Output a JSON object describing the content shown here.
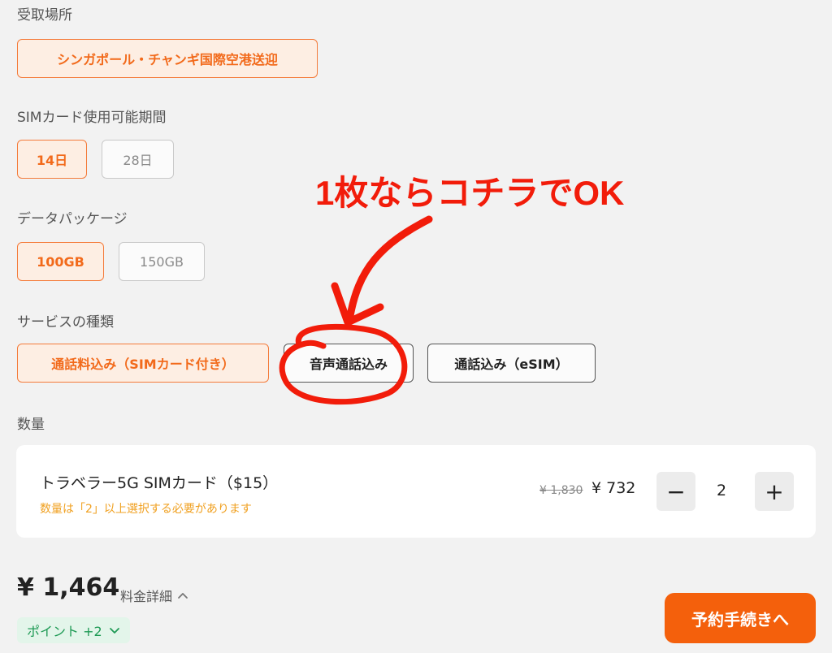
{
  "pickup": {
    "label": "受取場所",
    "option": "シンガポール・チャンギ国際空港送迎"
  },
  "sim_period": {
    "label": "SIMカード使用可能期間",
    "options": [
      "14日",
      "28日"
    ],
    "selected": "14日"
  },
  "data_package": {
    "label": "データパッケージ",
    "options": [
      "100GB",
      "150GB"
    ],
    "selected": "100GB"
  },
  "service_type": {
    "label": "サービスの種類",
    "options": [
      "通話料込み（SIMカード付き）",
      "音声通話込み",
      "通話込み（eSIM）"
    ],
    "selected": "通話料込み（SIMカード付き）"
  },
  "annotation": {
    "text": "1枚ならコチラでOK",
    "color": "#f21c0a"
  },
  "quantity": {
    "label": "数量",
    "product_name": "トラベラー5G SIMカード（$15）",
    "note": "数量は「2」以上選択する必要があります",
    "original_price": "¥ 1,830",
    "price": "¥ 732",
    "value": "2",
    "minus": "−",
    "plus": "+"
  },
  "footer": {
    "total": "¥ 1,464",
    "details_label": "料金詳細",
    "details_icon": "chevron-up-icon",
    "points_label": "ポイント +2",
    "points_icon": "chevron-down-icon",
    "reserve_label": "予約手続きへ"
  },
  "colors": {
    "accent": "#f26a1b",
    "accent_bg": "#fdeee3",
    "button": "#f4600c",
    "points_green": "#1f9a55",
    "note_orange": "#f0a020"
  }
}
